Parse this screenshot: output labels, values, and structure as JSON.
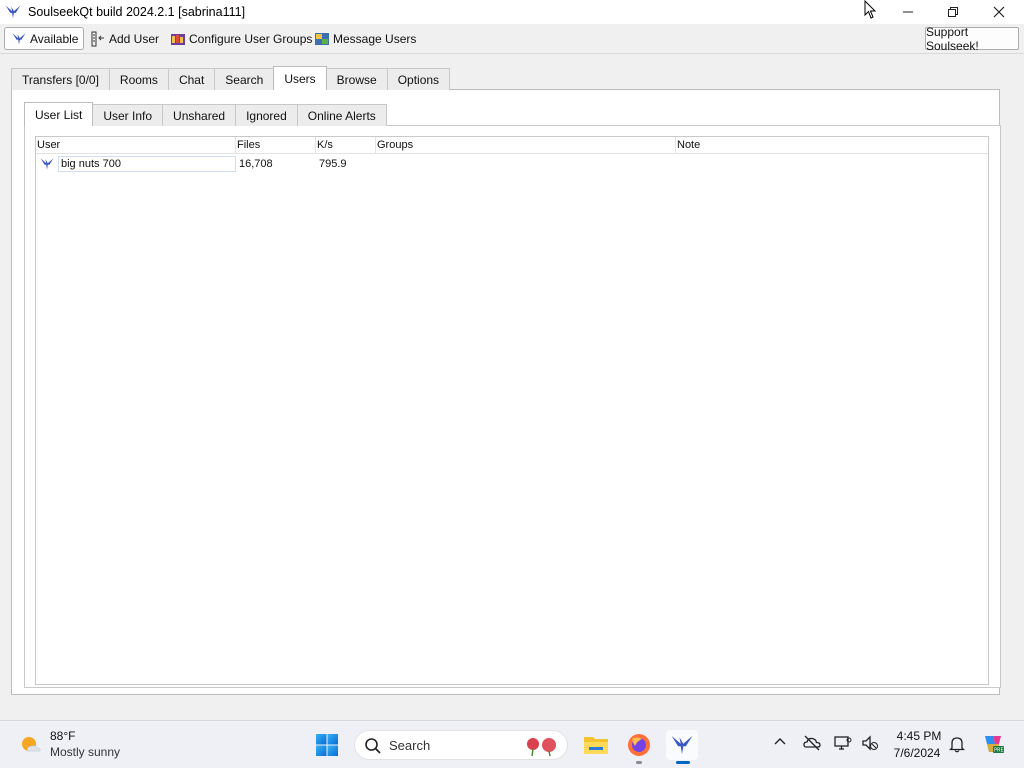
{
  "window": {
    "title": "SoulseekQt build 2024.2.1 [sabrina111]",
    "controls": [
      "minimize-icon",
      "restore-icon",
      "close-icon"
    ]
  },
  "toolbar": {
    "status_label": "Available",
    "add_user_label": "Add User",
    "configure_groups_label": "Configure User Groups",
    "message_users_label": "Message Users",
    "support_label": "Support Soulseek!"
  },
  "main_tabs": [
    {
      "label": "Transfers [0/0]",
      "active": false
    },
    {
      "label": "Rooms",
      "active": false
    },
    {
      "label": "Chat",
      "active": false
    },
    {
      "label": "Search",
      "active": false
    },
    {
      "label": "Users",
      "active": true
    },
    {
      "label": "Browse",
      "active": false
    },
    {
      "label": "Options",
      "active": false
    }
  ],
  "sub_tabs": [
    {
      "label": "User List",
      "active": true
    },
    {
      "label": "User Info",
      "active": false
    },
    {
      "label": "Unshared",
      "active": false
    },
    {
      "label": "Ignored",
      "active": false
    },
    {
      "label": "Online Alerts",
      "active": false
    }
  ],
  "user_table": {
    "columns": [
      "User",
      "Files",
      "K/s",
      "Groups",
      "Note"
    ],
    "rows": [
      {
        "user": "big nuts 700",
        "files": "16,708",
        "ks": "795.9",
        "groups": "",
        "note": ""
      }
    ]
  },
  "taskbar": {
    "weather": {
      "temp": "88°F",
      "desc": "Mostly sunny"
    },
    "search_placeholder": "Search",
    "pinned": [
      "windows-start-icon",
      "file-explorer-icon",
      "firefox-icon",
      "soulseek-icon"
    ],
    "clock": {
      "time": "4:45 PM",
      "date": "7/6/2024"
    }
  },
  "colors": {
    "accent": "#0067c0",
    "soulseek_blue": "#3b57c4"
  }
}
